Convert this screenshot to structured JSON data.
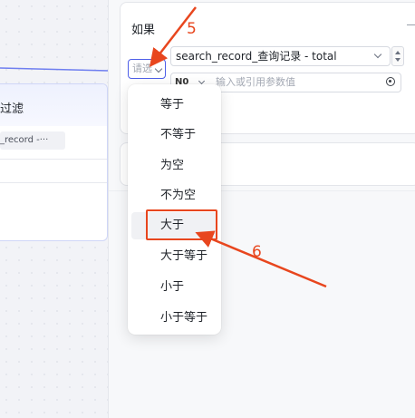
{
  "canvas": {
    "node_title": "过滤",
    "var_tag": "_record  -···"
  },
  "condition": {
    "title": "如果",
    "operator_placeholder": "请选",
    "left_field_value": "search_record_查询记录 - total",
    "type_value": "N0",
    "value_placeholder": "输入或引用参数值"
  },
  "dropdown": {
    "items": [
      "等于",
      "不等于",
      "为空",
      "不为空",
      "大于",
      "大于等于",
      "小于",
      "小于等于"
    ],
    "hover_index": 4
  },
  "annotations": {
    "step_5": "5",
    "step_6": "6",
    "color": "#e8461e"
  },
  "colors": {
    "accent": "#4e5fe8",
    "annotation": "#e8461e"
  }
}
